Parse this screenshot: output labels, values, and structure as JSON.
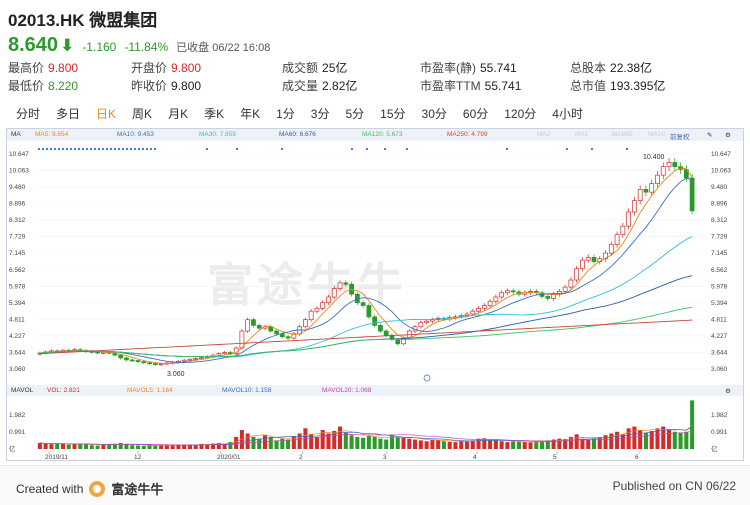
{
  "header": {
    "title": "02013.HK 微盟集团",
    "price": "8.640",
    "change": "-1.160",
    "change_pct": "-11.84%",
    "status": "已收盘 06/22 16:08"
  },
  "stats": [
    {
      "label": "最高价",
      "value": "9.800",
      "tone": "up"
    },
    {
      "label": "开盘价",
      "value": "9.800",
      "tone": "up"
    },
    {
      "label": "成交额",
      "value": "25亿",
      "tone": ""
    },
    {
      "label": "市盈率(静)",
      "value": "55.741",
      "tone": ""
    },
    {
      "label": "总股本",
      "value": "22.38亿",
      "tone": ""
    },
    {
      "label": "最低价",
      "value": "8.220",
      "tone": "dn"
    },
    {
      "label": "昨收价",
      "value": "9.800",
      "tone": ""
    },
    {
      "label": "成交量",
      "value": "2.82亿",
      "tone": ""
    },
    {
      "label": "市盈率TTM",
      "value": "55.741",
      "tone": ""
    },
    {
      "label": "总市值",
      "value": "193.395亿",
      "tone": ""
    }
  ],
  "tabs": [
    "分时",
    "多日",
    "日K",
    "周K",
    "月K",
    "季K",
    "年K",
    "1分",
    "3分",
    "5分",
    "15分",
    "30分",
    "60分",
    "120分",
    "4小时"
  ],
  "active_tab": "日K",
  "ma_legend": {
    "label": "MA",
    "items": [
      {
        "text": "MA5: 9.654",
        "color": "#e8891a"
      },
      {
        "text": "MA10: 9.453",
        "color": "#3a6fc4"
      },
      {
        "text": "MA30: 7.959",
        "color": "#2ec4d6"
      },
      {
        "text": "MA60: 6.676",
        "color": "#2a5aa8"
      },
      {
        "text": "MA120: 5.673",
        "color": "#3ac46a"
      },
      {
        "text": "MA250: 4.799",
        "color": "#c44a3a"
      },
      {
        "text": "MA2",
        "color": "#c8c8d8"
      },
      {
        "text": "MA1",
        "color": "#c8c8d8"
      },
      {
        "text": "MA860",
        "color": "#c8c8d8"
      },
      {
        "text": "MA10",
        "color": "#c8c8d8"
      }
    ],
    "adjust": "前复权"
  },
  "vol_legend": {
    "label": "MAVOL",
    "items": [
      {
        "text": "VOL: 2.821",
        "color": "#d42a2a"
      },
      {
        "text": "MAVOL5: 1.164",
        "color": "#e8891a"
      },
      {
        "text": "MAVOL10: 1.158",
        "color": "#3a6fc4"
      },
      {
        "text": "MAVOL20: 1.068",
        "color": "#c44aa8"
      }
    ]
  },
  "watermark": "富途牛牛",
  "annotations": {
    "high": "10.400",
    "low": "3.060"
  },
  "chart_data": {
    "type": "candlestick",
    "y_ticks": [
      "10.647",
      "10.063",
      "9.480",
      "8.896",
      "8.312",
      "7.729",
      "7.145",
      "6.562",
      "5.978",
      "5.394",
      "4.811",
      "4.227",
      "3.644",
      "3.060"
    ],
    "vol_ticks": [
      "1.982",
      "0.991",
      "亿"
    ],
    "x_ticks": [
      "2019/11",
      "12",
      "2020/01",
      "2",
      "3",
      "4",
      "5",
      "6"
    ],
    "closes": [
      3.62,
      3.66,
      3.7,
      3.68,
      3.72,
      3.7,
      3.74,
      3.71,
      3.68,
      3.66,
      3.63,
      3.65,
      3.62,
      3.55,
      3.45,
      3.38,
      3.36,
      3.32,
      3.28,
      3.25,
      3.22,
      3.24,
      3.27,
      3.3,
      3.33,
      3.37,
      3.4,
      3.43,
      3.46,
      3.5,
      3.55,
      3.6,
      3.64,
      3.6,
      3.8,
      4.4,
      4.8,
      4.6,
      4.5,
      4.55,
      4.4,
      4.3,
      4.2,
      4.15,
      4.3,
      4.55,
      4.8,
      5.1,
      5.2,
      5.4,
      5.6,
      5.9,
      6.1,
      6.05,
      5.7,
      5.4,
      5.3,
      4.9,
      4.6,
      4.4,
      4.25,
      4.1,
      3.95,
      4.15,
      4.4,
      4.55,
      4.7,
      4.75,
      4.8,
      4.85,
      4.82,
      4.88,
      4.9,
      4.95,
      5.0,
      5.1,
      5.2,
      5.3,
      5.45,
      5.6,
      5.75,
      5.82,
      5.78,
      5.7,
      5.75,
      5.8,
      5.75,
      5.62,
      5.55,
      5.7,
      5.8,
      5.95,
      6.2,
      6.6,
      6.9,
      7.0,
      6.85,
      6.95,
      7.15,
      7.45,
      7.8,
      8.1,
      8.6,
      9.0,
      9.4,
      9.3,
      9.6,
      9.9,
      10.2,
      10.35,
      10.2,
      10.1,
      9.8,
      8.64
    ],
    "volumes": [
      0.35,
      0.3,
      0.28,
      0.32,
      0.3,
      0.25,
      0.28,
      0.26,
      0.3,
      0.22,
      0.2,
      0.24,
      0.25,
      0.3,
      0.35,
      0.28,
      0.22,
      0.2,
      0.18,
      0.22,
      0.2,
      0.24,
      0.22,
      0.2,
      0.25,
      0.23,
      0.26,
      0.24,
      0.3,
      0.28,
      0.32,
      0.35,
      0.3,
      0.4,
      0.7,
      1.1,
      0.9,
      0.7,
      0.6,
      0.8,
      0.7,
      0.5,
      0.6,
      0.55,
      0.75,
      0.9,
      1.2,
      0.85,
      0.7,
      1.1,
      0.9,
      1.05,
      1.3,
      0.95,
      0.8,
      0.7,
      0.65,
      0.75,
      0.7,
      0.6,
      0.55,
      0.8,
      0.7,
      0.65,
      0.6,
      0.55,
      0.5,
      0.45,
      0.55,
      0.5,
      0.45,
      0.42,
      0.4,
      0.48,
      0.45,
      0.5,
      0.6,
      0.62,
      0.55,
      0.5,
      0.45,
      0.4,
      0.45,
      0.42,
      0.4,
      0.38,
      0.4,
      0.45,
      0.5,
      0.55,
      0.6,
      0.58,
      0.7,
      0.85,
      0.6,
      0.55,
      0.62,
      0.7,
      0.8,
      0.9,
      1.0,
      0.85,
      1.2,
      1.3,
      1.1,
      0.95,
      1.05,
      1.2,
      1.3,
      1.15,
      1.0,
      0.95,
      1.0,
      2.82
    ]
  }
}
